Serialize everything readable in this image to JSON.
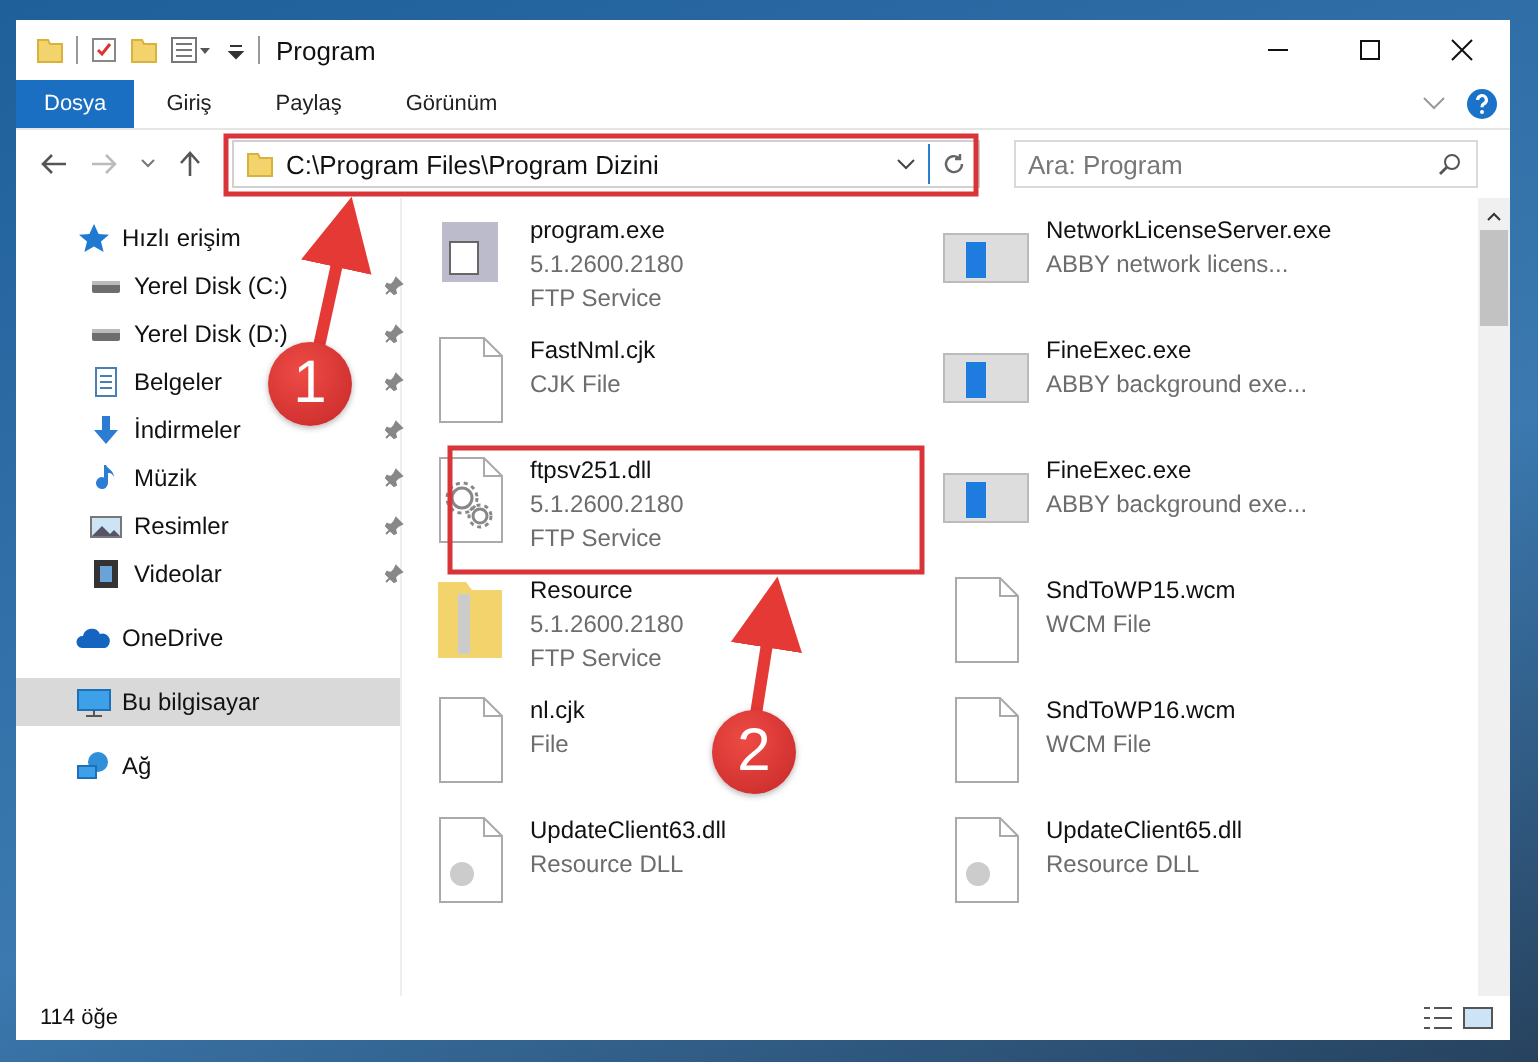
{
  "window": {
    "title": "Program"
  },
  "ribbon_tabs": [
    {
      "label": "Dosya",
      "selected": true
    },
    {
      "label": "Giriş",
      "selected": false
    },
    {
      "label": "Paylaş",
      "selected": false
    },
    {
      "label": "Görünüm",
      "selected": false
    }
  ],
  "address": {
    "path": "C:\\Program Files\\Program Dizini"
  },
  "search": {
    "placeholder": "Ara: Program"
  },
  "sidebar": {
    "items": [
      {
        "label": "Hızlı erişim",
        "kind": "star",
        "selected": false,
        "children": [
          {
            "label": "Yerel Disk (C:)",
            "kind": "drive",
            "pinned": true,
            "selected": false
          },
          {
            "label": "Yerel Disk (D:)",
            "kind": "drive",
            "pinned": true,
            "selected": false
          },
          {
            "label": "Belgeler",
            "kind": "doc",
            "pinned": true,
            "selected": false
          },
          {
            "label": "İndirmeler",
            "kind": "download",
            "pinned": true,
            "selected": false
          },
          {
            "label": "Müzik",
            "kind": "music",
            "pinned": true,
            "selected": false
          },
          {
            "label": "Resimler",
            "kind": "picture",
            "pinned": true,
            "selected": false
          },
          {
            "label": "Videolar",
            "kind": "video",
            "pinned": true,
            "selected": false
          }
        ]
      },
      {
        "label": "OneDrive",
        "kind": "cloud",
        "selected": false
      },
      {
        "label": "Bu bilgisayar",
        "kind": "pc",
        "selected": true
      },
      {
        "label": "Ağ",
        "kind": "network",
        "selected": false
      }
    ]
  },
  "files": [
    {
      "name": "program.exe",
      "lines": [
        "5.1.2600.2180",
        "FTP Service"
      ],
      "kind": "exe"
    },
    {
      "name": "NetworkLicenseServer.exe",
      "lines": [
        "ABBY network licens..."
      ],
      "kind": "app"
    },
    {
      "name": "FastNml.cjk",
      "lines": [
        "CJK File"
      ],
      "kind": "file"
    },
    {
      "name": "FineExec.exe",
      "lines": [
        "ABBY background exe..."
      ],
      "kind": "app"
    },
    {
      "name": "ftpsv251.dll",
      "lines": [
        "5.1.2600.2180",
        "FTP Service"
      ],
      "kind": "gear"
    },
    {
      "name": "FineExec.exe",
      "lines": [
        "ABBY background exe..."
      ],
      "kind": "app"
    },
    {
      "name": "Resource",
      "lines": [
        "5.1.2600.2180",
        "FTP Service"
      ],
      "kind": "folder"
    },
    {
      "name": "SndToWP15.wcm",
      "lines": [
        "WCM File"
      ],
      "kind": "file"
    },
    {
      "name": "nl.cjk",
      "lines": [
        "File"
      ],
      "kind": "file"
    },
    {
      "name": "SndToWP16.wcm",
      "lines": [
        "WCM File"
      ],
      "kind": "file"
    },
    {
      "name": "UpdateClient63.dll",
      "lines": [
        "Resource DLL"
      ],
      "kind": "dll"
    },
    {
      "name": "UpdateClient65.dll",
      "lines": [
        "Resource DLL"
      ],
      "kind": "dll"
    }
  ],
  "annotations": [
    {
      "number": "1"
    },
    {
      "number": "2"
    }
  ],
  "status_bar": {
    "count": "114 öğe"
  }
}
